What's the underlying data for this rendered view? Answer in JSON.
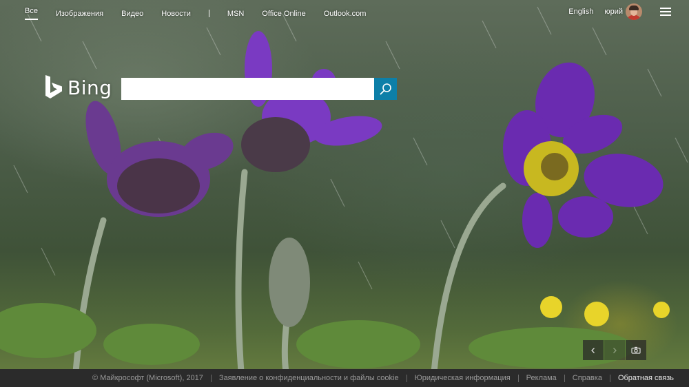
{
  "nav": {
    "items": [
      {
        "label": "Все",
        "active": true
      },
      {
        "label": "Изображения"
      },
      {
        "label": "Видео"
      },
      {
        "label": "Новости"
      },
      {
        "label": "MSN"
      },
      {
        "label": "Office Online"
      },
      {
        "label": "Outlook.com"
      }
    ],
    "language": "English",
    "user_name": "юрий"
  },
  "logo": {
    "text": "Bing"
  },
  "search": {
    "value": "",
    "placeholder": ""
  },
  "image_controls": {
    "prev_icon": "chevron-left-icon",
    "next_icon": "chevron-right-icon",
    "camera_icon": "camera-icon"
  },
  "footer": {
    "copyright": "© Майкрософт (Microsoft), 2017",
    "privacy": "Заявление о конфиденциальности и файлы cookie",
    "legal": "Юридическая информация",
    "ads": "Реклама",
    "help": "Справка",
    "feedback": "Обратная связь"
  },
  "colors": {
    "search_button": "#0d7fa8",
    "footer_bg": "#2b2b2b",
    "flower_purple": "#6a2bb0"
  }
}
